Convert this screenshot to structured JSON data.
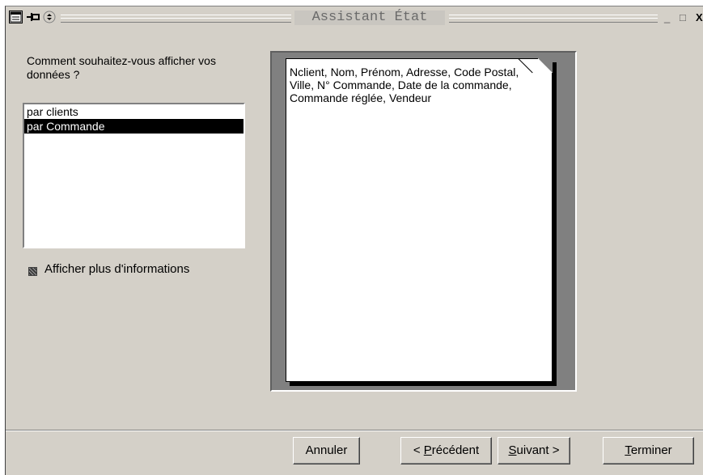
{
  "window": {
    "title": "Assistant État",
    "controls": {
      "minimize": "_",
      "maximize": "□",
      "close": "X"
    }
  },
  "left": {
    "question": "Comment souhaitez-vous afficher vos données ?",
    "options": [
      "par clients",
      "par Commande"
    ],
    "selected_index": 1,
    "more_info_label": "Afficher plus d'informations"
  },
  "preview": {
    "text": "Nclient, Nom, Prénom, Adresse, Code Postal, Ville, N° Commande, Date de la commande, Commande réglée, Vendeur"
  },
  "buttons": {
    "cancel": {
      "label": "Annuler"
    },
    "previous": {
      "prefix": "< ",
      "accel": "P",
      "rest": "récédent"
    },
    "next": {
      "accel": "S",
      "rest": "uivant",
      "suffix": " >"
    },
    "finish": {
      "accel": "T",
      "rest": "erminer"
    }
  }
}
